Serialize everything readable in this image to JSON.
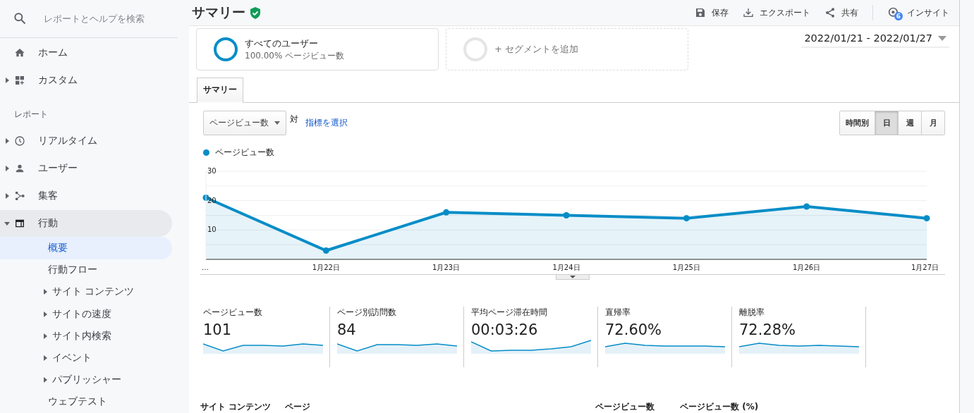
{
  "sidebar": {
    "search": {
      "placeholder": "レポートとヘルプを検索"
    },
    "items": [
      {
        "label": "ホーム",
        "expandable": false,
        "expanded": false
      },
      {
        "label": "カスタム",
        "expandable": true,
        "expanded": false
      }
    ],
    "section": "レポート",
    "reports": [
      {
        "label": "リアルタイム",
        "expandable": true,
        "expanded": false
      },
      {
        "label": "ユーザー",
        "expandable": true,
        "expanded": false
      },
      {
        "label": "集客",
        "expandable": true,
        "expanded": false
      },
      {
        "label": "行動",
        "expandable": true,
        "expanded": true,
        "children": [
          {
            "label": "概要",
            "expandable": false,
            "selected": true
          },
          {
            "label": "行動フロー",
            "expandable": false,
            "selected": false
          },
          {
            "label": "サイト コンテンツ",
            "expandable": true,
            "selected": false
          },
          {
            "label": "サイトの速度",
            "expandable": true,
            "selected": false
          },
          {
            "label": "サイト内検索",
            "expandable": true,
            "selected": false
          },
          {
            "label": "イベント",
            "expandable": true,
            "selected": false
          },
          {
            "label": "パブリッシャー",
            "expandable": true,
            "selected": false
          },
          {
            "label": "ウェブテスト",
            "expandable": false,
            "selected": false
          }
        ]
      }
    ]
  },
  "header": {
    "title": "サマリー",
    "actions": [
      {
        "label": "保存"
      },
      {
        "label": "エクスポート"
      },
      {
        "label": "共有"
      },
      {
        "label": "インサイト",
        "badge": "6"
      }
    ]
  },
  "segments": [
    {
      "kind": "segment",
      "title": "すべてのユーザー",
      "subtitle": "100.00% ページビュー数"
    },
    {
      "kind": "add",
      "title": "+ セグメントを追加"
    }
  ],
  "date_range": "2022/01/21 - 2022/01/27",
  "tabs": [
    {
      "label": "サマリー",
      "selected": true
    }
  ],
  "metric_select": "ページビュー数",
  "versus": "対",
  "select_metric_link": "指標を選択",
  "granularity": [
    {
      "label": "時間別",
      "selected": false
    },
    {
      "label": "日",
      "selected": true
    },
    {
      "label": "週",
      "selected": false
    },
    {
      "label": "月",
      "selected": false
    }
  ],
  "chart": {
    "chart_data": {
      "type": "area",
      "categories": [
        "…",
        "1月22日",
        "1月23日",
        "1月24日",
        "1月25日",
        "1月26日",
        "1月27日"
      ],
      "series": [
        {
          "name": "ページビュー数",
          "color": "#058dc7",
          "values": [
            21,
            3,
            16,
            15,
            14,
            18,
            14
          ]
        }
      ],
      "ylim": [
        0,
        30
      ],
      "yticks": [
        10,
        20,
        30
      ]
    }
  },
  "metrics": [
    {
      "label": "ページビュー数",
      "value": "101"
    },
    {
      "label": "ページ別訪問数",
      "value": "84"
    },
    {
      "label": "平均ページ滞在時間",
      "value": "00:03:26"
    },
    {
      "label": "直帰率",
      "value": "72.60%"
    },
    {
      "label": "離脱率",
      "value": "72.28%"
    }
  ],
  "table_header": [
    "サイト コンテンツ",
    "ページ",
    "ページビュー数",
    "ページビュー数 (%)"
  ]
}
